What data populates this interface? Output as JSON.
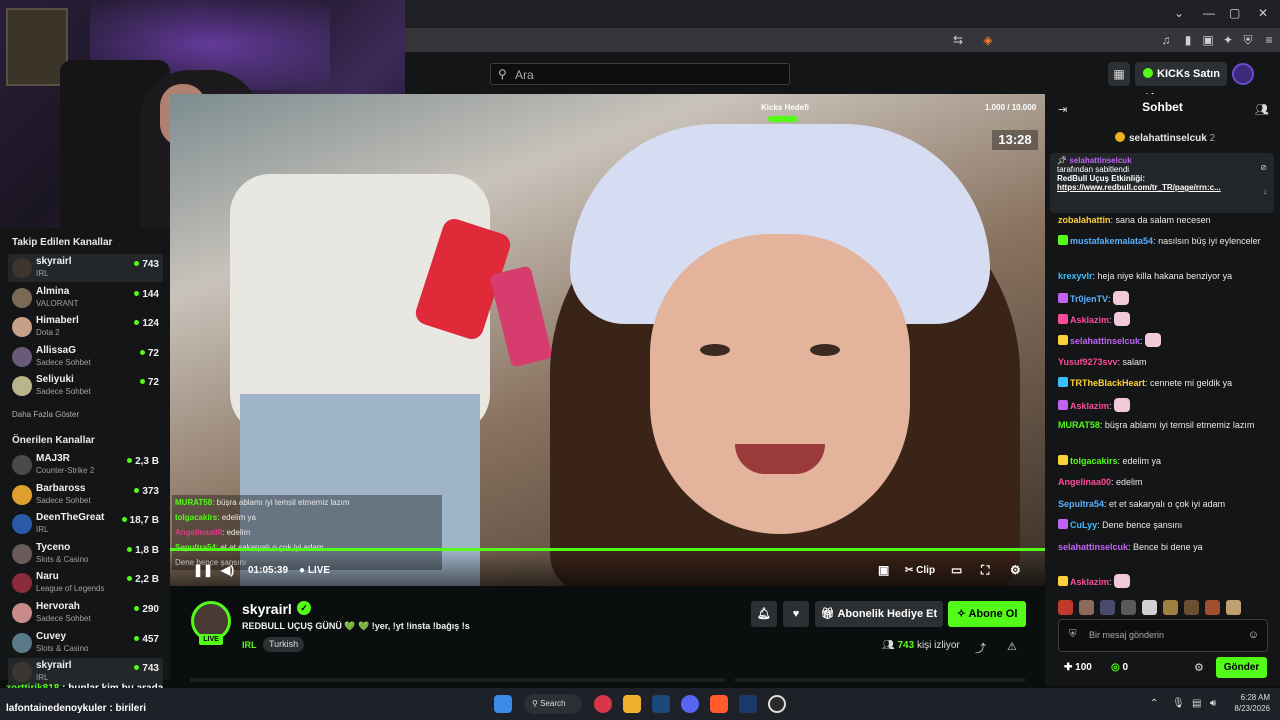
{
  "search": {
    "placeholder": "Ara"
  },
  "header": {
    "kicks_button": "KICKs Satın Al"
  },
  "sidebar": {
    "followed_title": "Takip Edilen Kanallar",
    "followed": [
      {
        "name": "skyrairl",
        "category": "IRL",
        "viewers": "743",
        "color": "#3d3530"
      },
      {
        "name": "Almina",
        "category": "VALORANT",
        "viewers": "144",
        "color": "#7a6a55"
      },
      {
        "name": "Himaberl",
        "category": "Dota 2",
        "viewers": "124",
        "color": "#c7a089"
      },
      {
        "name": "AllissaG",
        "category": "Sadece Sohbet",
        "viewers": "72",
        "color": "#6a5a7a"
      },
      {
        "name": "Seliyuki",
        "category": "Sadece Sohbet",
        "viewers": "72",
        "color": "#b9b48c"
      }
    ],
    "show_more": "Daha Fazla Göster",
    "recommended_title": "Önerilen Kanallar",
    "recommended": [
      {
        "name": "MAJ3R",
        "category": "Counter-Strike 2",
        "viewers": "2,3 B",
        "color": "#4a4a4a"
      },
      {
        "name": "Barbaross",
        "category": "Sadece Sohbet",
        "viewers": "373",
        "color": "#e0a030"
      },
      {
        "name": "DeenTheGreat",
        "category": "IRL",
        "viewers": "18,7 B",
        "color": "#2a5aa8"
      },
      {
        "name": "Tyceno",
        "category": "Slots & Casino",
        "viewers": "1,8 B",
        "color": "#6a5a5a"
      },
      {
        "name": "Naru",
        "category": "League of Legends",
        "viewers": "2,2 B",
        "color": "#8a2a3a"
      },
      {
        "name": "Hervorah",
        "category": "Sadece Sohbet",
        "viewers": "290",
        "color": "#c98a8a"
      },
      {
        "name": "Cuvey",
        "category": "Slots & Casino",
        "viewers": "457",
        "color": "#5a7a8a"
      },
      {
        "name": "skyrairl",
        "category": "IRL",
        "viewers": "743",
        "color": "#3d3530"
      }
    ]
  },
  "video": {
    "goal_label": "Kicks Hedefi",
    "goal_count": "1.000 / 10.000",
    "timer": "13:28",
    "elapsed": "01:05:39",
    "live_label": "LIVE",
    "clip_label": "Clip",
    "overlay_chat": [
      {
        "user": "MURAT58",
        "text": ": büşra ablamı iyi temsil etmemiz lazım",
        "color": "#53fc18"
      },
      {
        "user": "tolgacakirs",
        "text": ": edelim ya",
        "color": "#53fc18"
      },
      {
        "user": "Angelinaa00",
        "text": ": edelim",
        "color": "#e03a8a"
      },
      {
        "user": "Sepultra54",
        "text": ": et et sakaryalı o çok iyi adam",
        "color": "#53fc18"
      },
      {
        "user": "",
        "text": "Dene bence şansını",
        "color": "#ddd"
      }
    ]
  },
  "stream": {
    "name": "skyrairl",
    "live_tag": "LIVE",
    "title": "REDBULL UÇUŞ GÜNÜ 💚 💚 !yer, !yt !insta !bağış !s",
    "category": "IRL",
    "tag": "Turkish",
    "gift_button": "Abonelik Hediye Et",
    "subscribe_button": "Abone Ol",
    "viewer_count": "743",
    "viewer_suffix": "kişi izliyor"
  },
  "chat": {
    "title": "Sohbet",
    "top_gifter": "selahattinselcuk",
    "top_gifter_count": "2",
    "pinned": {
      "user": "selahattinselcuk",
      "by": "tarafından sabitlendi",
      "text": "RedBull Uçuş Etkinliği:",
      "link": "https://www.redbull.com/tr_TR/page/rrn:c..."
    },
    "messages": [
      {
        "user": "zobalahattin",
        "text": ": sana da salam necesen",
        "color": "#ffd23a"
      },
      {
        "user": "mustafakemalata54",
        "text": ": nasılsın büş iyi eylenceler",
        "color": "#5ab0ff"
      },
      {
        "user": "krexyvlr",
        "text": ": heja niye killa hakana benziyor ya",
        "color": "#3ac0ff"
      },
      {
        "user": "Tr0jenTV",
        "text": ":",
        "color": "#5ab0ff"
      },
      {
        "user": "Asklazim",
        "text": ":",
        "color": "#ff4a9a"
      },
      {
        "user": "selahattinselcuk",
        "text": ":",
        "color": "#c063f5"
      },
      {
        "user": "Yusuf9273svv",
        "text": ": salam",
        "color": "#ff4a9a"
      },
      {
        "user": "TRTheBlackHeart",
        "text": ": cennete mi geldik ya",
        "color": "#ffd23a"
      },
      {
        "user": "Asklazim",
        "text": ":",
        "color": "#ff4a9a"
      },
      {
        "user": "MURAT58",
        "text": ": büşra ablamı iyi temsil etmemiz lazım",
        "color": "#53fc18"
      },
      {
        "user": "tolgacakirs",
        "text": ": edelim ya",
        "color": "#53fc18"
      },
      {
        "user": "Angelinaa00",
        "text": ": edelim",
        "color": "#ff4a9a"
      },
      {
        "user": "Sepultra54",
        "text": ": et et sakaryalı o çok iyi adam",
        "color": "#5ab0ff"
      },
      {
        "user": "CuLyy",
        "text": ": Dene bence şansını",
        "color": "#3ac0ff"
      },
      {
        "user": "selahattinselcuk",
        "text": ": Bence bi dene ya",
        "color": "#c063f5"
      },
      {
        "user": "Asklazim",
        "text": ":",
        "color": "#ff4a9a"
      }
    ],
    "input_placeholder": "Bir mesaj gönderin",
    "points": "100",
    "kicks_balance": "0",
    "send_button": "Gönder"
  },
  "overlay_bottom": [
    {
      "user": "zorttirik818",
      "text": " : bunlar kim bu arada"
    },
    {
      "user": "lafontainedenoykuler",
      "text": " : birileri"
    }
  ],
  "taskbar": {
    "search_label": "Search",
    "time": "6:28 AM",
    "date": "8/23/2026"
  }
}
